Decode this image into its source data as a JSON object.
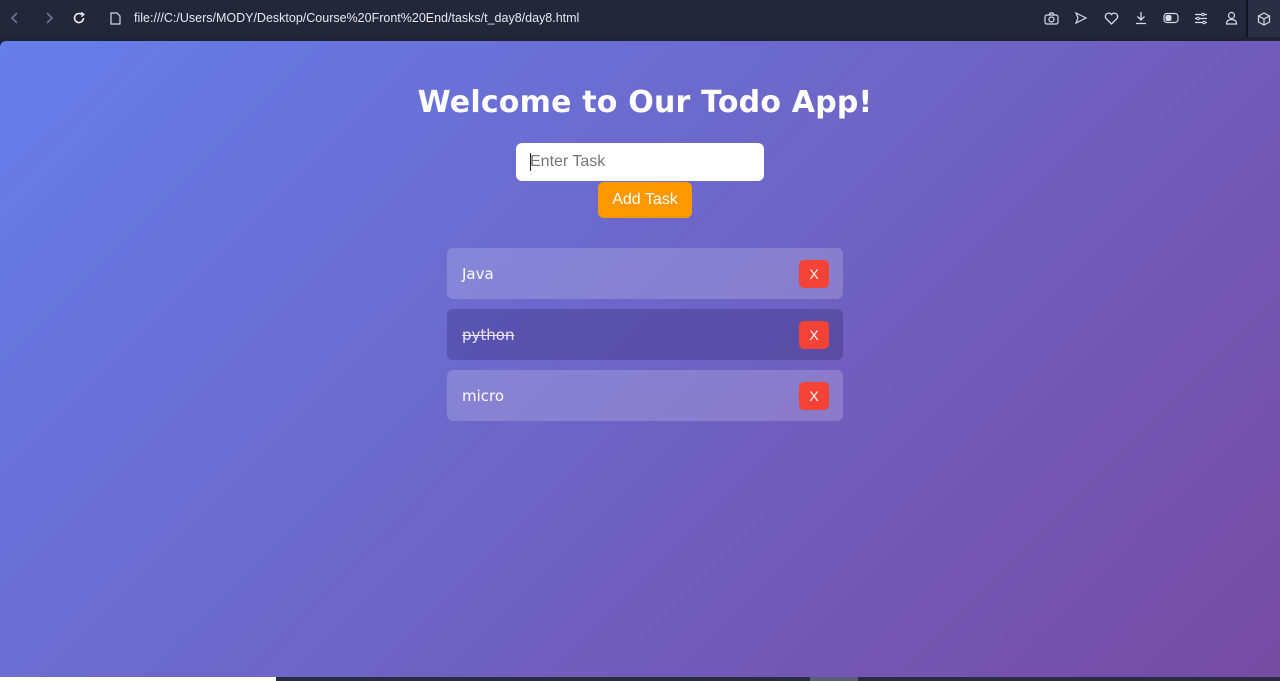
{
  "browser": {
    "url": "file:///C:/Users/MODY/Desktop/Course%20Front%20End/tasks/t_day8/day8.html"
  },
  "app": {
    "title": "Welcome to Our Todo App!",
    "input_placeholder": "Enter Task",
    "add_button_label": "Add Task",
    "delete_label": "X",
    "accent_color": "#ff9800",
    "delete_color": "#f44336",
    "tasks": [
      {
        "label": "Java",
        "done": false
      },
      {
        "label": "python",
        "done": true
      },
      {
        "label": "micro",
        "done": false
      }
    ]
  }
}
